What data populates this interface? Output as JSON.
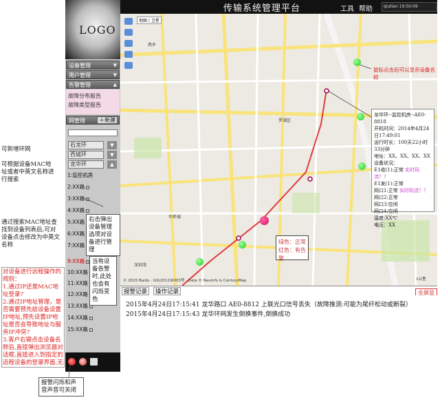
{
  "app": {
    "title": "传输系统管理平台",
    "logo": "LOGO",
    "toolbar": {
      "tools": "工具",
      "help": "帮助"
    },
    "status_bar": "qiutian  19:50:09"
  },
  "sidebar": {
    "menus": [
      "设备管理",
      "用户管理",
      "告警管理"
    ],
    "submenu": [
      "故障分布报告",
      "故障类型报告"
    ],
    "net_header": "网管理",
    "new_button": "新建",
    "rings": [
      "石龙环",
      "西城环",
      "龙华环"
    ],
    "nodes": [
      "1:监控机房",
      "2:XX路",
      "3:XX路",
      "4:XX路",
      "5:XX路",
      "6:XX路",
      "7:XX路",
      "8:XX路",
      "9:XX路",
      "10:XX路",
      "11:XX路",
      "12:XX路",
      "13:XX路",
      "14:XX路",
      "15:XX路"
    ]
  },
  "map": {
    "labels": [
      "地图",
      "卫星",
      "罗湖区",
      "华侨城",
      "深圳湾",
      "西乡"
    ],
    "popup": {
      "lines": [
        "龙华环--监控机房--AE0-8818",
        "开机时间：2014年4月24日17:49:01",
        "运行时长：100天22小时33分钟",
        "地址：XX、XX、XX、XX",
        "设备状况：",
        "E1收(1):正常",
        "E1发(1):正常",
        "网口1:正常",
        "网口2:正常",
        "网口3:空闲",
        "网口4:空闲",
        "温度:XX℃",
        "电压：XX"
      ],
      "realtime_lines": [
        "实时码流？？",
        "实时码流？？"
      ]
    },
    "legend": [
      "绿色：正常",
      "红色：有告警"
    ],
    "copyright": "© 2015 Baidu · GS(2012)6003号 · Data © NavInfo & CenturyMap",
    "scale": "1公里"
  },
  "alarm": {
    "tabs": [
      "报警记录",
      "操作记录"
    ],
    "fullscreen": "全屏显示",
    "records": [
      "2015年4月24日17:15:41  龙华路口 AE0-8812 上联光口信号丢失（故障推测:可能为尾纤松动或断裂）",
      "2015年4月24日17:15:43  龙华环网发生倒换事件,倒换成功"
    ]
  },
  "annotations": {
    "new_ring": "可新增环网",
    "search": "可根据设备MAC地址或者中英文名称进行搜索",
    "mac_search": "通过搜索MAC地址查找到设备列表后,可对设备点击修改为中英文名称",
    "right_menu": "右击弹出设备管理选项对设备进行管理",
    "alarm_device": "当有设备告警时,此处也会有闪烁变色",
    "map_click": "鼠标点击后可以显示设备名称",
    "login_flow": [
      "对设备进行远程操作的规则：",
      "1.通过IP还是MAC地址登录?",
      "2.通过IP地址管理，是否需要预先给设备设置IP地址,预先设置IP地址是否会导致地址与服务IP冲突?",
      "3.客户右键点击设备名称后,直接弹出浏览器对话框,直接进入到指定的远程设备的登录界面,无需输入用户名密码"
    ],
    "sound": "报警闪烁和声音声音可关闭"
  },
  "colors": {
    "accent_red": "#d22222",
    "ok_green": "#33cc33",
    "alarm_red": "#e0105a",
    "topbar": "#121212"
  },
  "icons": [
    "zoom-control-icon",
    "green-node-icon",
    "red-node-icon",
    "alarm-flash-icon",
    "sound-icon"
  ]
}
